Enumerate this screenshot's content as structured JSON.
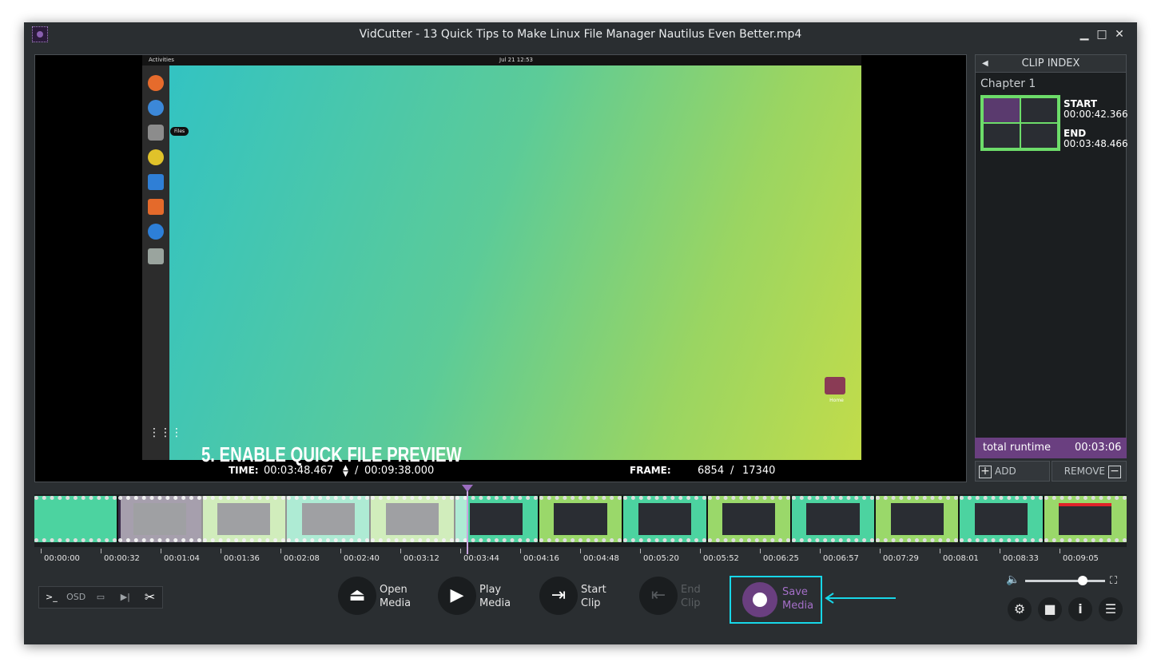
{
  "window": {
    "title": "VidCutter - 13 Quick Tips to Make Linux File Manager Nautilus Even Better.mp4",
    "controls": {
      "minimize": "▁",
      "maximize": "□",
      "close": "✕"
    }
  },
  "video": {
    "desktop_topbar": {
      "activities": "Activities",
      "clock": "Jul 21  12:53"
    },
    "files_tooltip": "Files",
    "home_label": "Home",
    "overlay_text": "5. Enable Quick File Preview"
  },
  "status": {
    "time_label": "TIME:",
    "time_current": "00:03:48.467",
    "time_separator": "/",
    "time_total": "00:09:38.000",
    "frame_label": "FRAME:",
    "frame_current": "6854",
    "frame_separator": "/",
    "frame_total": "17340"
  },
  "clip_index": {
    "header": "CLIP INDEX",
    "chapter": "Chapter 1",
    "clips": [
      {
        "start_label": "START",
        "start": "00:00:42.366",
        "end_label": "END",
        "end": "00:03:48.466"
      }
    ],
    "runtime_label": "total runtime",
    "runtime_value": "00:03:06",
    "add_label": "ADD",
    "remove_label": "REMOVE"
  },
  "timeline": {
    "ticks": [
      "00:00:00",
      "00:00:32",
      "00:01:04",
      "00:01:36",
      "00:02:08",
      "00:02:40",
      "00:03:12",
      "00:03:44",
      "00:04:16",
      "00:04:48",
      "00:05:20",
      "00:05:52",
      "00:06:25",
      "00:06:57",
      "00:07:29",
      "00:08:01",
      "00:08:33",
      "00:09:05"
    ],
    "playhead_fraction": 0.396,
    "selection_start_fraction": 0.073,
    "selection_end_fraction": 0.396
  },
  "left_toolbar": {
    "console": ">_",
    "osd": "OSD",
    "cut": "✂"
  },
  "media_buttons": {
    "open": "Open\nMedia",
    "play": "Play\nMedia",
    "start": "Start\nClip",
    "end": "End\nClip",
    "save": "Save\nMedia"
  },
  "volume": {
    "level": 0.72
  },
  "colors": {
    "accent_purple": "#6a3f80",
    "highlight_cyan": "#17d7e8",
    "window_bg": "#2a2e31"
  }
}
